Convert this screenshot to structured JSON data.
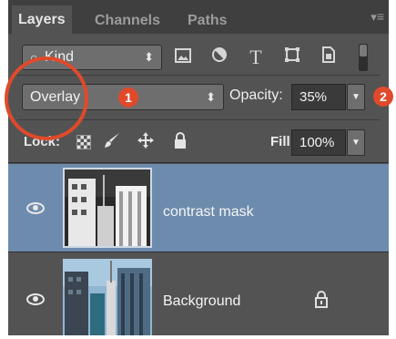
{
  "panel": {
    "tabs": [
      {
        "label": "Layers",
        "active": true
      },
      {
        "label": "Channels",
        "active": false
      },
      {
        "label": "Paths",
        "active": false
      }
    ],
    "menu_icon": "panel-menu-icon"
  },
  "filter": {
    "kind_label": "Kind",
    "icons": [
      "pixel-layer-filter-icon",
      "adjustment-layer-filter-icon",
      "type-layer-filter-icon",
      "shape-layer-filter-icon",
      "smart-object-filter-icon"
    ],
    "type_glyph": "T"
  },
  "blend": {
    "mode": "Overlay",
    "opacity_label": "Opacity:",
    "opacity_value": "35%"
  },
  "lock": {
    "label": "Lock:",
    "fill_label": "Fill:",
    "fill_value": "100%"
  },
  "layers": [
    {
      "name": "contrast mask",
      "selected": true,
      "visible": true,
      "locked": false
    },
    {
      "name": "Background",
      "selected": false,
      "visible": true,
      "locked": true
    }
  ],
  "annotations": {
    "callout_1": "1",
    "callout_2": "2",
    "color": "#e04a2b"
  },
  "colors": {
    "panel_bg": "#535353",
    "selected_layer": "#6d8bad"
  }
}
